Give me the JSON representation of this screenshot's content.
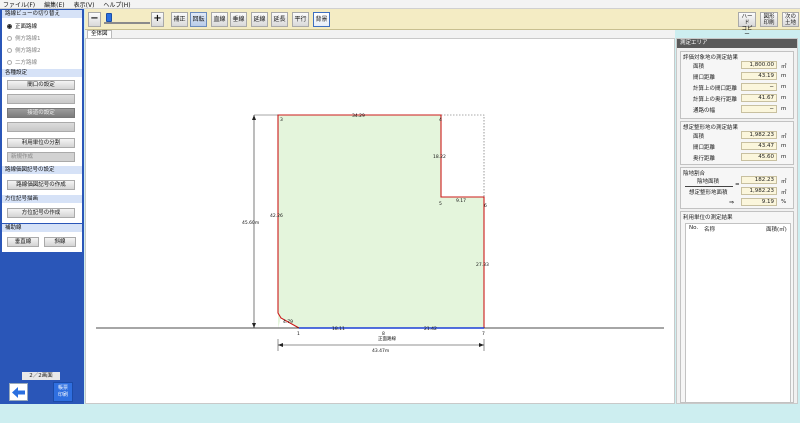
{
  "menu": [
    "ファイル(F)",
    "編集(E)",
    "表示(V)",
    "ヘルプ(H)"
  ],
  "left": {
    "view_switch_title": "路線ビューの切り替え",
    "view_options": [
      {
        "label": "正面路線",
        "selected": true
      },
      {
        "label": "側方路線1",
        "selected": false
      },
      {
        "label": "側方路線2",
        "selected": false
      },
      {
        "label": "二方路線",
        "selected": false
      }
    ],
    "settings_title": "各種設定",
    "frontage_setting": "間口の設定",
    "contour_setting": "接道の設定",
    "split_usage": "利用単位の分割",
    "new_create": "新規作成",
    "route_price_title": "路線価図記号の設定",
    "route_price_create": "路線価図記号の作成",
    "direction_title": "方位記号描画",
    "direction_create": "方位記号の作成",
    "aux_title": "補助線",
    "vertical_line": "垂直線",
    "oblique_line": "斜線",
    "page_indicator": "2／2画面",
    "print_label": "帳票印刷"
  },
  "toolbar": {
    "zoom_out": "−",
    "zoom_in": "+",
    "zoom_level": 0.05,
    "buttons": [
      "補正",
      "回転",
      "直線",
      "垂線",
      "延線",
      "延長",
      "平行",
      "背景"
    ],
    "hardcopy": "ハード\nコピー",
    "figure_print": "図形\n印刷",
    "next_land": "次の\n土地"
  },
  "tab_label": "全体図",
  "drawing": {
    "edges": [
      "34.29",
      "18.22",
      "9.17",
      "27.33",
      "21.42",
      "18.11",
      "4.79",
      "42.26"
    ],
    "vertices": [
      "1",
      "2",
      "3",
      "4",
      "5",
      "6",
      "7",
      "8"
    ],
    "frontage_road": "正面路線",
    "depth_dim": "45.60m",
    "width_dim": "43.47m"
  },
  "panel": {
    "header": "測定エリア",
    "eval_title": "評価対象地の測定結果",
    "eval_rows": [
      {
        "label": "面積",
        "value": "1,800.00",
        "unit": "㎡"
      },
      {
        "label": "間口距離",
        "value": "43.19",
        "unit": "m"
      },
      {
        "label": "計算上の間口距離",
        "value": "−",
        "unit": "m"
      },
      {
        "label": "計算上の奥行距離",
        "value": "41.67",
        "unit": "m"
      },
      {
        "label": "通路の幅",
        "value": "−",
        "unit": "m"
      }
    ],
    "assumed_title": "想定整形地の測定結果",
    "assumed_rows": [
      {
        "label": "面積",
        "value": "1,982.23",
        "unit": "㎡"
      },
      {
        "label": "間口距離",
        "value": "43.47",
        "unit": "m"
      },
      {
        "label": "奥行距離",
        "value": "45.60",
        "unit": "m"
      }
    ],
    "gap_title": "陰地割合",
    "gap_area_label": "陰地面積",
    "gap_area_value": "182.23",
    "assumed_area_label": "想定整形地面積",
    "assumed_area_value": "1,982.23",
    "ratio_value": "9.19",
    "equals": "=",
    "arrow": "⇒",
    "unit_m2": "㎡",
    "unit_pct": "%",
    "unit_title": "利用単位の測定結果",
    "col_no": "No.",
    "col_name": "名称",
    "col_area": "面積(㎡)"
  },
  "colors": {
    "land_fill": "#e4f5dc",
    "boundary": "#cc1a1a",
    "frontage": "#1c3fd6",
    "accent": "#2a56b8"
  }
}
